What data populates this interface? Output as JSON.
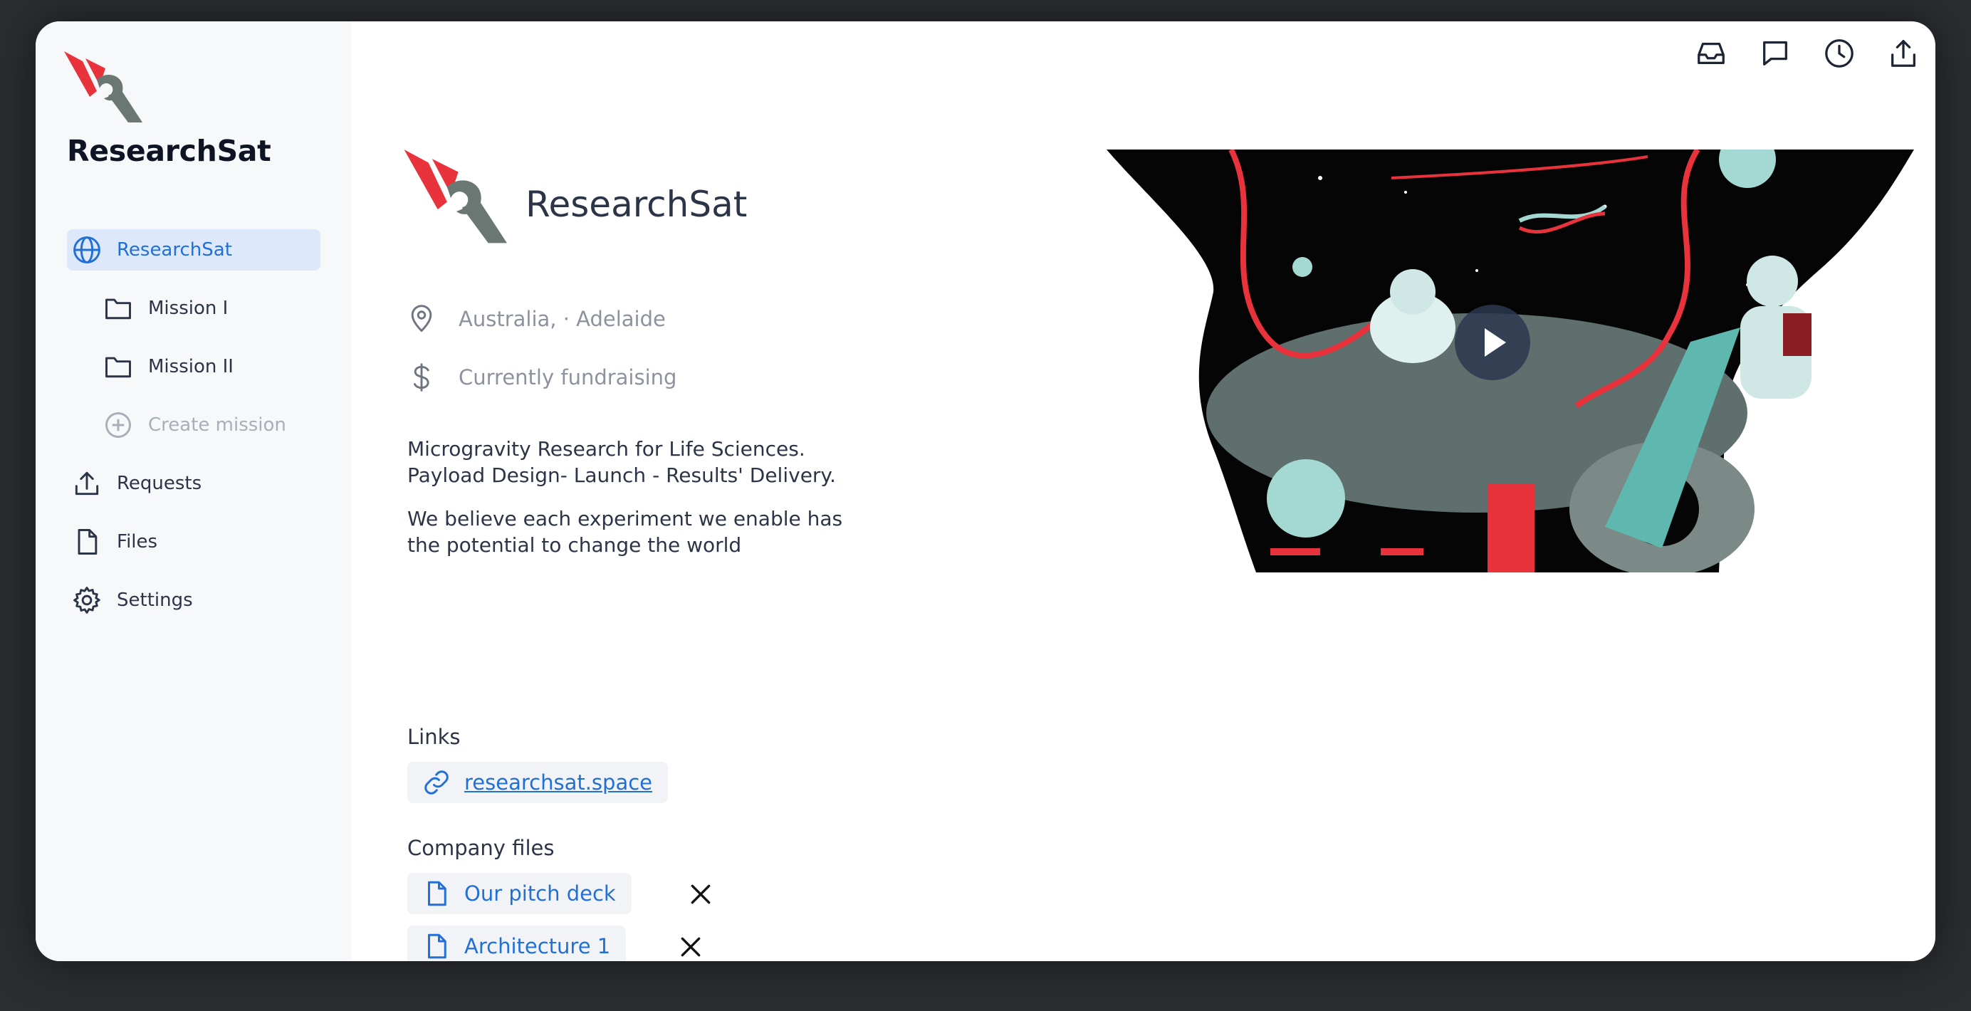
{
  "brand": {
    "name": "ResearchSat"
  },
  "sidebar": {
    "items": [
      {
        "label": "ResearchSat"
      },
      {
        "label": "Mission I"
      },
      {
        "label": "Mission II"
      },
      {
        "label": "Create mission"
      },
      {
        "label": "Requests"
      },
      {
        "label": "Files"
      },
      {
        "label": "Settings"
      }
    ]
  },
  "topbar": {
    "icons": [
      "inbox-icon",
      "chat-icon",
      "clock-icon",
      "share-icon"
    ]
  },
  "company": {
    "name": "ResearchSat",
    "location": "Australia, · Adelaide",
    "status": "Currently fundraising",
    "description_1_line1": "Microgravity Research for Life Sciences.",
    "description_1_line2": "Payload Design- Launch - Results' Delivery.",
    "description_2_line1": "We believe each experiment we enable has",
    "description_2_line2": "the potential to change the world"
  },
  "links": {
    "title": "Links",
    "items": [
      {
        "label": "researchsat.space"
      }
    ]
  },
  "files": {
    "title": "Company files",
    "items": [
      {
        "label": "Our pitch deck"
      },
      {
        "label": "Architecture 1"
      }
    ]
  },
  "colors": {
    "accent": "#2270d6",
    "brand_red": "#e8333c",
    "brand_gray": "#6a7772"
  }
}
